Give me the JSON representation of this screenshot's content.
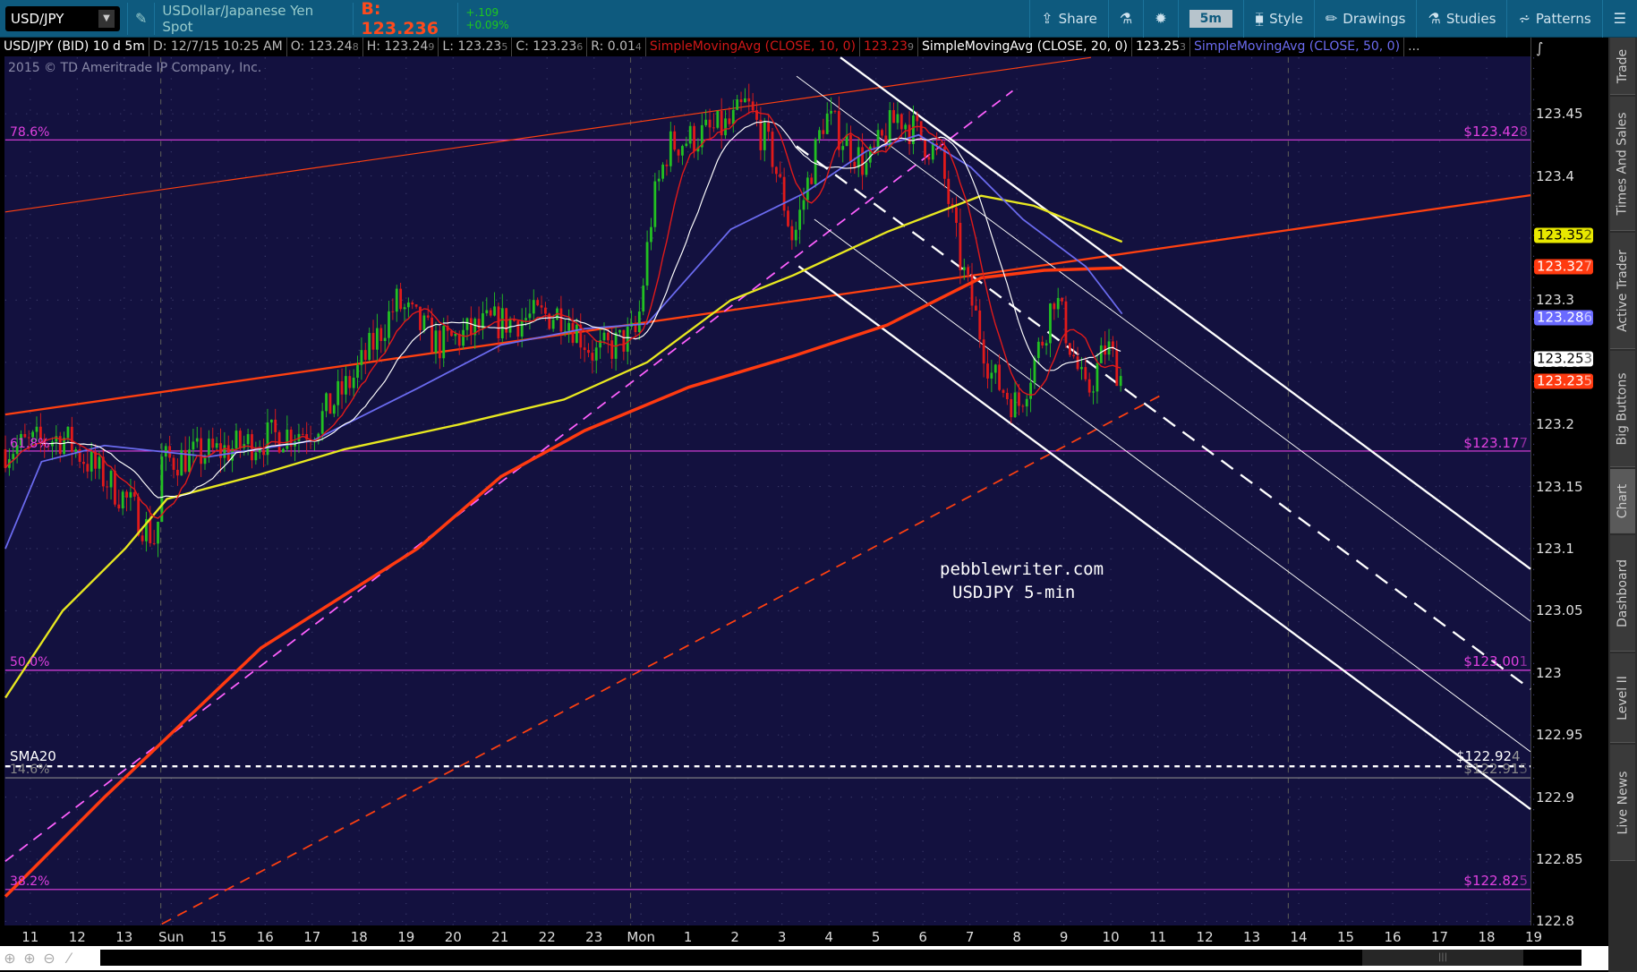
{
  "toolbar": {
    "symbol": "USD/JPY",
    "description": "USDollar/Japanese Yen Spot",
    "bid": "B: 123.236",
    "change": "+.109",
    "change_pct": "+0.09%",
    "share": "Share",
    "timeframe": "5m",
    "style": "Style",
    "drawings": "Drawings",
    "studies": "Studies",
    "patterns": "Patterns"
  },
  "info": {
    "title": "USD/JPY (BID) 10 d 5m",
    "date": "D: 12/7/15 10:25 AM",
    "open": "O: 123.24",
    "open_d": "8",
    "high": "H: 123.24",
    "high_d": "9",
    "low": "L: 123.23",
    "low_d": "5",
    "close": "C: 123.23",
    "close_d": "6",
    "range": "R: 0.01",
    "range_d": "4",
    "sma10_label": "SimpleMovingAvg (CLOSE, 10, 0)",
    "sma10_val": "123.23",
    "sma10_d": "9",
    "sma20_label": "SimpleMovingAvg (CLOSE, 20, 0)",
    "sma20_val": "123.25",
    "sma20_d": "3",
    "sma50_label": "SimpleMovingAvg (CLOSE, 50, 0)",
    "more": "..."
  },
  "copyright": "2015 © TD Ameritrade IP Company, Inc.",
  "watermark": [
    "pebblewriter.com",
    "USDJPY 5-min"
  ],
  "y_axis": [
    "123.45",
    "123.4",
    "123.35",
    "123.3",
    "123.25",
    "123.2",
    "123.15",
    "123.1",
    "123.05",
    "123",
    "122.95",
    "122.9",
    "122.85",
    "122.8"
  ],
  "badges": [
    {
      "main": "123.35",
      "d": "2",
      "price": 123.352,
      "bg": "#e8e800",
      "fg": "#000"
    },
    {
      "main": "123.32",
      "d": "7",
      "price": 123.327,
      "bg": "#ff3a10",
      "fg": "#fff"
    },
    {
      "main": "123.28",
      "d": "6",
      "price": 123.286,
      "bg": "#6a6aff",
      "fg": "#fff"
    },
    {
      "main": "123.25",
      "d": "3",
      "price": 123.253,
      "bg": "#ffffff",
      "fg": "#000"
    },
    {
      "main": "123.23",
      "d": "5",
      "price": 123.235,
      "bg": "#ff3a10",
      "fg": "#fff"
    }
  ],
  "fib_levels": [
    {
      "pct": "78.6%",
      "main": "$123.42",
      "d": "8",
      "price": 123.428,
      "color": "#e040e0"
    },
    {
      "pct": "61.8%",
      "main": "$123.17",
      "d": "7",
      "price": 123.177,
      "color": "#e040e0"
    },
    {
      "pct": "50.0%",
      "main": "$123.00",
      "d": "1",
      "price": 123.001,
      "color": "#e040e0"
    },
    {
      "pct": "14.6%",
      "main": "$122.91",
      "d": "5",
      "price": 122.915,
      "color": "#888888"
    },
    {
      "pct": "38.2%",
      "main": "$122.82",
      "d": "5",
      "price": 122.825,
      "color": "#e040e0"
    }
  ],
  "sma20_line": {
    "label": "SMA20",
    "main": "$122.92",
    "d": "4",
    "price": 122.924
  },
  "x_axis": [
    "11",
    "12",
    "13",
    "Sun",
    "15",
    "16",
    "17",
    "18",
    "19",
    "20",
    "21",
    "22",
    "23",
    "Mon",
    "1",
    "2",
    "3",
    "4",
    "5",
    "6",
    "7",
    "8",
    "9",
    "10",
    "11",
    "12",
    "13",
    "14",
    "15",
    "16",
    "17",
    "18",
    "19"
  ],
  "sidebar_tabs": [
    {
      "label": "Trade",
      "selected": false
    },
    {
      "label": "Times And Sales",
      "selected": false
    },
    {
      "label": "Active Trader",
      "selected": false
    },
    {
      "label": "Big Buttons",
      "selected": false
    },
    {
      "label": "Chart",
      "selected": true
    },
    {
      "label": "Dashboard",
      "selected": false
    },
    {
      "label": "Level II",
      "selected": false
    },
    {
      "label": "Live News",
      "selected": false
    }
  ],
  "colors": {
    "up": "#22c022",
    "down": "#e01a1a",
    "sma10": "#e01a1a",
    "sma20": "#ffffff",
    "sma50": "#6b6bf0",
    "sma_yellow": "#e8e820",
    "sma_long": "#ff3a10"
  },
  "chart_data": {
    "type": "candlestick",
    "x_unit": "hour-label index (0 = first label)",
    "price_path": [
      [
        -0.53,
        123.18
      ],
      [
        0.69,
        123.19
      ],
      [
        2.02,
        123.14
      ],
      [
        2.69,
        123.105
      ],
      [
        2.8,
        123.17
      ],
      [
        4.24,
        123.18
      ],
      [
        5.13,
        123.19
      ],
      [
        6.02,
        123.197
      ],
      [
        6.91,
        123.239
      ],
      [
        7.8,
        123.298
      ],
      [
        8.69,
        123.264
      ],
      [
        9.8,
        123.281
      ],
      [
        11.36,
        123.29
      ],
      [
        12.02,
        123.256
      ],
      [
        12.91,
        123.273
      ],
      [
        13.24,
        123.374
      ],
      [
        13.58,
        123.424
      ],
      [
        14.91,
        123.441
      ],
      [
        15.24,
        123.458
      ],
      [
        15.8,
        123.416
      ],
      [
        16.24,
        123.348
      ],
      [
        16.91,
        123.449
      ],
      [
        17.8,
        123.407
      ],
      [
        18.47,
        123.449
      ],
      [
        19.36,
        123.416
      ],
      [
        19.8,
        123.331
      ],
      [
        20.47,
        123.239
      ],
      [
        21.02,
        123.214
      ],
      [
        21.58,
        123.273
      ],
      [
        21.8,
        123.306
      ],
      [
        22.47,
        123.222
      ],
      [
        22.91,
        123.264
      ],
      [
        23.24,
        123.236
      ]
    ],
    "yellow_ma": [
      [
        -0.53,
        122.98
      ],
      [
        0.69,
        123.05
      ],
      [
        2.02,
        123.1
      ],
      [
        2.91,
        123.14
      ],
      [
        4.91,
        123.16
      ],
      [
        6.69,
        123.18
      ],
      [
        9.13,
        123.2
      ],
      [
        11.36,
        123.22
      ],
      [
        13.13,
        123.25
      ],
      [
        14.91,
        123.3
      ],
      [
        16.24,
        123.32
      ],
      [
        18.24,
        123.355
      ],
      [
        20.24,
        123.384
      ],
      [
        21.36,
        123.376
      ],
      [
        23.24,
        123.347
      ]
    ],
    "long_ma": [
      [
        -0.53,
        122.82
      ],
      [
        1.58,
        122.9
      ],
      [
        4.91,
        123.02
      ],
      [
        8.24,
        123.1
      ],
      [
        10.02,
        123.158
      ],
      [
        11.8,
        123.195
      ],
      [
        14.02,
        123.23
      ],
      [
        16.24,
        123.255
      ],
      [
        18.24,
        123.28
      ],
      [
        20.24,
        123.318
      ],
      [
        21.58,
        123.324
      ],
      [
        23.24,
        123.326
      ]
    ],
    "sma50": [
      [
        -0.53,
        123.1
      ],
      [
        0.24,
        123.17
      ],
      [
        1.58,
        123.183
      ],
      [
        3.8,
        123.174
      ],
      [
        6.02,
        123.187
      ],
      [
        8.24,
        123.229
      ],
      [
        10.02,
        123.264
      ],
      [
        11.8,
        123.277
      ],
      [
        13.13,
        123.281
      ],
      [
        14.91,
        123.357
      ],
      [
        16.47,
        123.386
      ],
      [
        17.8,
        123.42
      ],
      [
        18.91,
        123.433
      ],
      [
        20.02,
        123.407
      ],
      [
        21.13,
        123.365
      ],
      [
        22.47,
        123.327
      ],
      [
        23.24,
        123.289
      ]
    ]
  }
}
